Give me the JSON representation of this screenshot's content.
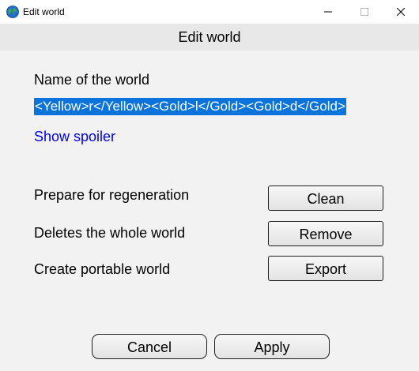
{
  "window": {
    "title": "Edit world"
  },
  "header": {
    "title": "Edit world"
  },
  "form": {
    "name_label": "Name of the world",
    "name_value": "<Yellow>r</Yellow><Gold>l</Gold><Gold>d</Gold>",
    "spoiler_link": "Show spoiler"
  },
  "actions": [
    {
      "description": "Prepare for regeneration",
      "button": "Clean"
    },
    {
      "description": "Deletes the whole world",
      "button": "Remove"
    },
    {
      "description": "Create portable world",
      "button": "Export"
    }
  ],
  "footer": {
    "cancel_label": "Cancel",
    "apply_label": "Apply"
  },
  "colors": {
    "selection": "#0a74da",
    "link": "#0000ee",
    "background": "#f2f2f2",
    "header_band": "#e8e8e8"
  }
}
